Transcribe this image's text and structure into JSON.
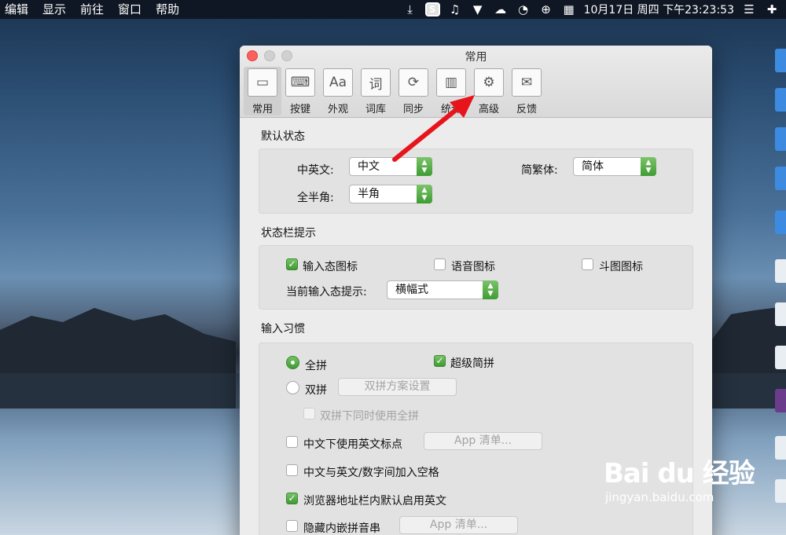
{
  "menubar": {
    "items": [
      "编辑",
      "显示",
      "前往",
      "窗口",
      "帮助"
    ],
    "clock": "10月17日 周四 下午23:23:53"
  },
  "window": {
    "title": "常用",
    "toolbar": [
      {
        "label": "常用",
        "glyph": "▭"
      },
      {
        "label": "按键",
        "glyph": "⌨"
      },
      {
        "label": "外观",
        "glyph": "Aa"
      },
      {
        "label": "词库",
        "glyph": "词"
      },
      {
        "label": "同步",
        "glyph": "⟳"
      },
      {
        "label": "统计",
        "glyph": "▥"
      },
      {
        "label": "高级",
        "glyph": "⚙"
      },
      {
        "label": "反馈",
        "glyph": "✉"
      }
    ],
    "default_state": {
      "title": "默认状态",
      "cn_en_label": "中英文:",
      "cn_en_value": "中文",
      "trad_simp_label": "简繁体:",
      "trad_simp_value": "简体",
      "width_label": "全半角:",
      "width_value": "半角"
    },
    "status_bar": {
      "title": "状态栏提示",
      "input_icon": "输入态图标",
      "voice_icon": "语音图标",
      "meme_icon": "斗图图标",
      "hint_label": "当前输入态提示:",
      "hint_value": "横幅式"
    },
    "habits": {
      "title": "输入习惯",
      "quanpin": "全拼",
      "super_jianpin": "超级简拼",
      "shuangpin": "双拼",
      "shuangpin_setup": "双拼方案设置",
      "shuangpin_also_quanpin": "双拼下同时使用全拼",
      "en_punct": "中文下使用英文标点",
      "app_list_1": "App 清单...",
      "space_between": "中文与英文/数字间加入空格",
      "browser_en": "浏览器地址栏内默认启用英文",
      "hide_pinyin": "隐藏内嵌拼音串",
      "app_list_2": "App 清单..."
    }
  },
  "watermark": {
    "logo": "Bai du 经验",
    "url": "jingyan.baidu.com"
  },
  "colors": {
    "accent_green": "#4fae40",
    "arrow_red": "#e8141c"
  }
}
